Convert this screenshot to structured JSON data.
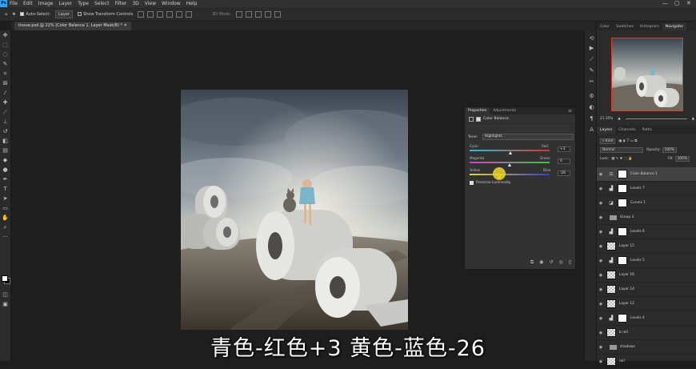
{
  "menubar": {
    "items": [
      "File",
      "Edit",
      "Image",
      "Layer",
      "Type",
      "Select",
      "Filter",
      "3D",
      "View",
      "Window",
      "Help"
    ]
  },
  "options": {
    "autoselect_label": "Auto-Select:",
    "autoselect_value": "Layer",
    "transform_label": "Show Transform Controls",
    "mode3d": "3D Mode:"
  },
  "document_tab": "tissue.psd @ 22% (Color Balance 1, Layer Mask/8) *",
  "properties": {
    "tabs": [
      "Properties",
      "Adjustments"
    ],
    "header": "Color Balance",
    "tone_label": "Tone:",
    "tone_value": "Highlights",
    "sliders": [
      {
        "left": "Cyan",
        "right": "Red",
        "value": "+3",
        "level": 0.515
      },
      {
        "left": "Magenta",
        "right": "Green",
        "value": "0",
        "level": 0.5
      },
      {
        "left": "Yellow",
        "right": "Blue",
        "value": "-26",
        "level": 0.37
      }
    ],
    "preserve_label": "Preserve Luminosity"
  },
  "navigator": {
    "tabs": [
      "Color",
      "Swatches",
      "Histogram",
      "Navigator"
    ],
    "zoom": "21.35%"
  },
  "layers_panel": {
    "tabs": [
      "Layers",
      "Channels",
      "Paths"
    ],
    "kind_label": "Kind",
    "blend_mode": "Normal",
    "opacity_label": "Opacity:",
    "opacity_value": "100%",
    "lock_label": "Lock:",
    "fill_label": "Fill:",
    "fill_value": "100%",
    "layers": [
      {
        "name": "Color Balance 1",
        "type": "adj",
        "icon": "⚖",
        "selected": true
      },
      {
        "name": "Levels 7",
        "type": "adj",
        "icon": "▟"
      },
      {
        "name": "Curves 1",
        "type": "adj",
        "icon": "◪"
      },
      {
        "name": "Group 3",
        "type": "group"
      },
      {
        "name": "Levels 6",
        "type": "adj",
        "icon": "▟"
      },
      {
        "name": "Layer 15",
        "type": "pixel"
      },
      {
        "name": "Levels 5",
        "type": "adj",
        "icon": "▟"
      },
      {
        "name": "Layer 16",
        "type": "pixel"
      },
      {
        "name": "Layer 14",
        "type": "pixel"
      },
      {
        "name": "Layer 12",
        "type": "pixel"
      },
      {
        "name": "Levels 4",
        "type": "adj",
        "icon": "▟"
      },
      {
        "name": "b roll",
        "type": "pixel"
      },
      {
        "name": "shadows",
        "type": "group"
      },
      {
        "name": "roll",
        "type": "pixel"
      }
    ]
  },
  "subtitle": "青色-红色+3 黄色-蓝色-26",
  "colors": {
    "accent": "#2fa3f7",
    "highlight": "#f0d728",
    "nav_frame": "#e03a2e"
  }
}
